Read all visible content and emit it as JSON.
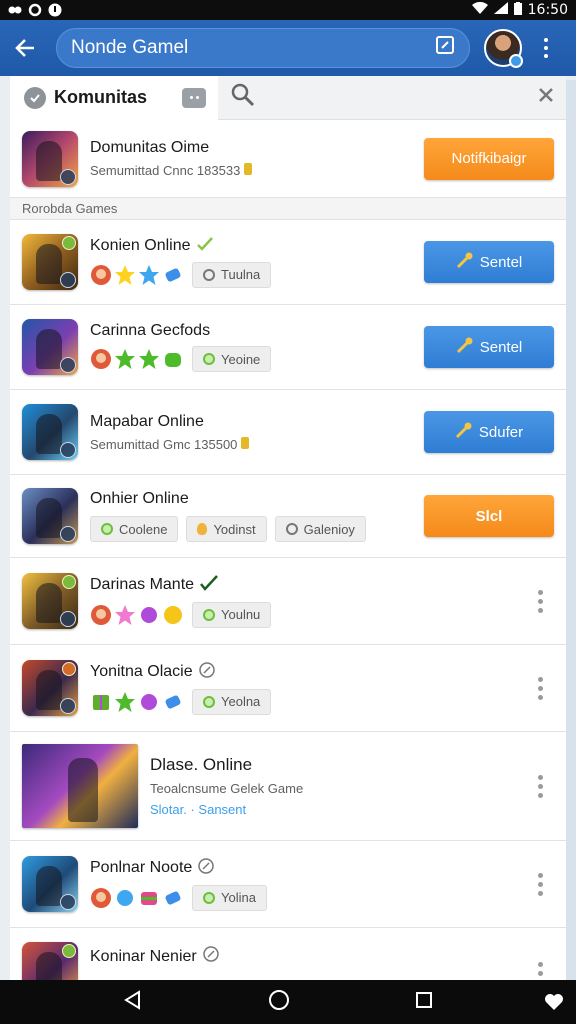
{
  "status_bar": {
    "time": "16:50"
  },
  "app_bar": {
    "search_title": "Nonde Gamel"
  },
  "tabs": {
    "active_label": "Komunitas"
  },
  "featured": {
    "name": "Domunitas Oime",
    "subtitle": "Semumittad Cnnc 183533",
    "button": "Notifkibaigr"
  },
  "section_label": "Rorobda Games",
  "rows": [
    {
      "name": "Konien Online",
      "chip": "Tuulna",
      "button": "Sentel"
    },
    {
      "name": "Carinna Gecfods",
      "chip": "Yeoine",
      "button": "Sentel"
    },
    {
      "name": "Mapabar Online",
      "subtitle": "Semumittad Gmc 135500",
      "button": "Sdufer"
    },
    {
      "name": "Onhier Online",
      "chips": [
        "Coolene",
        "Yodinst",
        "Galenioy"
      ],
      "button": "Slcl"
    },
    {
      "name": "Darinas Mante",
      "chip": "Youlnu"
    },
    {
      "name": "Yonitna Olacie",
      "chip": "Yeolna"
    },
    {
      "name": "Dlase. Online",
      "subtitle": "Teoalcnsume Gelek Game",
      "link_a": "Slotar.",
      "link_b": "Sansent"
    },
    {
      "name": "Ponlnar Noote",
      "chip": "Yolina"
    },
    {
      "name": "Koninar Nenier"
    }
  ],
  "colors": {
    "appbar": "#1f59a8",
    "orange": "#f48a1a",
    "blue": "#2f7dd4"
  }
}
